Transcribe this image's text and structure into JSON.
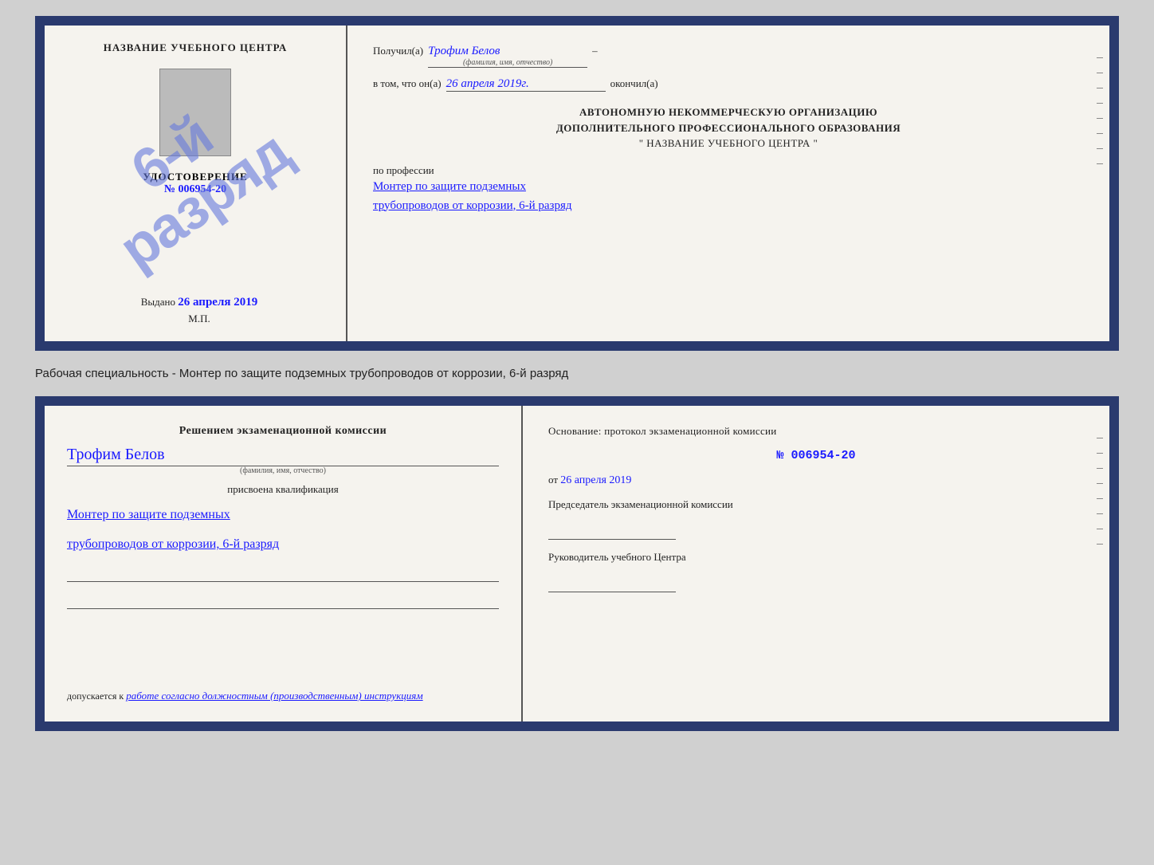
{
  "top_cert": {
    "left": {
      "title": "НАЗВАНИЕ УЧЕБНОГО ЦЕНТРА",
      "stamp_line1": "6-й",
      "stamp_line2": "разряд",
      "udostoverenie_label": "УДОСТОВЕРЕНИЕ",
      "number": "№ 006954-20",
      "vydano_label": "Выдано",
      "vydano_date": "26 апреля 2019",
      "mp": "М.П."
    },
    "right": {
      "poluchil_label": "Получил(а)",
      "person_name": "Трофим Белов",
      "fio_hint": "(фамилия, имя, отчество)",
      "dash": "–",
      "v_tom_label": "в том, что он(а)",
      "date_val": "26 апреля 2019г.",
      "okончил_label": "окончил(а)",
      "org_line1": "АВТОНОМНУЮ НЕКОММЕРЧЕСКУЮ ОРГАНИЗАЦИЮ",
      "org_line2": "ДОПОЛНИТЕЛЬНОГО ПРОФЕССИОНАЛЬНОГО ОБРАЗОВАНИЯ",
      "org_line3": "\" НАЗВАНИЕ УЧЕБНОГО ЦЕНТРА \"",
      "po_professii": "по профессии",
      "profession_line1": "Монтер по защите подземных",
      "profession_line2": "трубопроводов от коррозии, 6-й разряд"
    }
  },
  "middle": {
    "text": "Рабочая специальность - Монтер по защите подземных трубопроводов от коррозии, 6-й разряд"
  },
  "bottom_cert": {
    "left": {
      "resheniem": "Решением экзаменационной комиссии",
      "person_name": "Трофим Белов",
      "fio_hint": "(фамилия, имя, отчество)",
      "prisvoena": "присвоена квалификация",
      "qual_line1": "Монтер по защите подземных",
      "qual_line2": "трубопроводов от коррозии, 6-й разряд",
      "dopuskaetsya_label": "допускается к",
      "dopuskaetsya_val": "работе согласно должностным (производственным) инструкциям"
    },
    "right": {
      "osnov_label": "Основание: протокол экзаменационной комиссии",
      "protocol_num": "№ 006954-20",
      "ot_label": "от",
      "ot_date": "26 апреля 2019",
      "predsedatel_label": "Председатель экзаменационной комиссии",
      "rukovoditel_label": "Руководитель учебного Центра"
    }
  }
}
